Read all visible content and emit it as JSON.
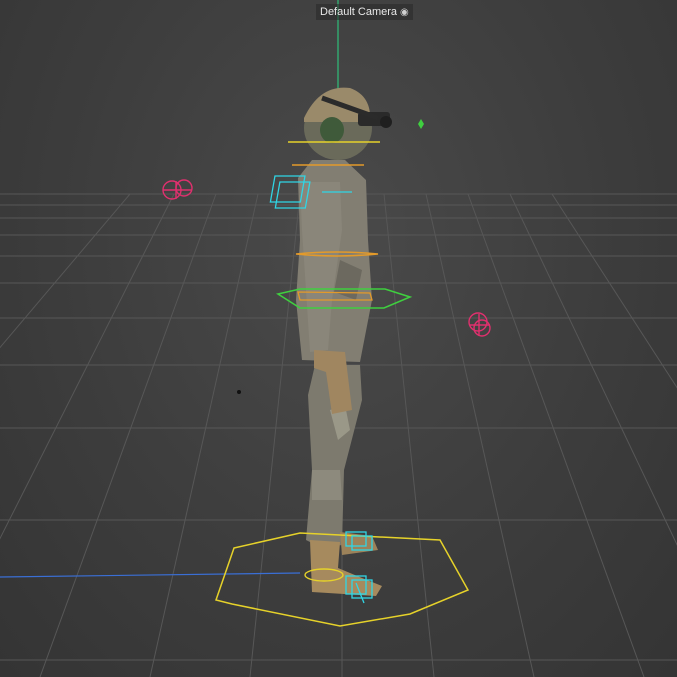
{
  "viewport": {
    "camera_label": "Default Camera",
    "camera_icon": "camera-icon",
    "colors": {
      "background": "#3d3d3d",
      "grid": "#5a5a5a",
      "y_axis": "#2fbf7a",
      "x_axis": "#3a6fd6",
      "controller_yellow": "#e6d22a",
      "controller_orange": "#e39a2a",
      "controller_green": "#3fcf3f",
      "controller_cyan": "#2fd6e6",
      "target_magenta": "#e0306e"
    }
  }
}
